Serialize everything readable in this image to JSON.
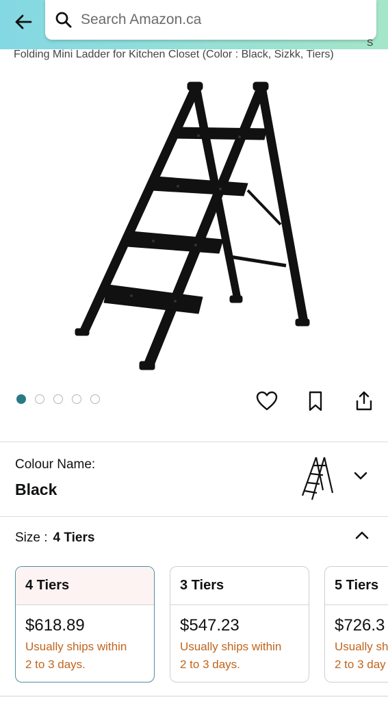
{
  "search": {
    "placeholder": "Search Amazon.ca"
  },
  "header": {
    "right_stub": "S"
  },
  "product": {
    "title": "Folding Mini Ladder for Kitchen Closet (Color : Black, Sizkk, Tiers)"
  },
  "gallery": {
    "count": 5,
    "active_index": 0
  },
  "colour": {
    "label": "Colour Name:",
    "value": "Black"
  },
  "size": {
    "label": "Size :",
    "value": "4 Tiers"
  },
  "size_options": [
    {
      "name": "4 Tiers",
      "price": "$618.89",
      "ship_line1": "Usually ships within",
      "ship_line2": "2 to 3 days."
    },
    {
      "name": "3 Tiers",
      "price": "$547.23",
      "ship_line1": "Usually ships within",
      "ship_line2": "2 to 3 days."
    },
    {
      "name": "5 Tiers",
      "price": "$726.3",
      "ship_line1": "Usually sh",
      "ship_line2": "2 to 3 day"
    }
  ],
  "colors": {
    "accent": "#2a7a86",
    "shipping_text": "#c0641d",
    "header_gradient_start": "#84d8e3",
    "header_gradient_end": "#a5e6c9"
  }
}
